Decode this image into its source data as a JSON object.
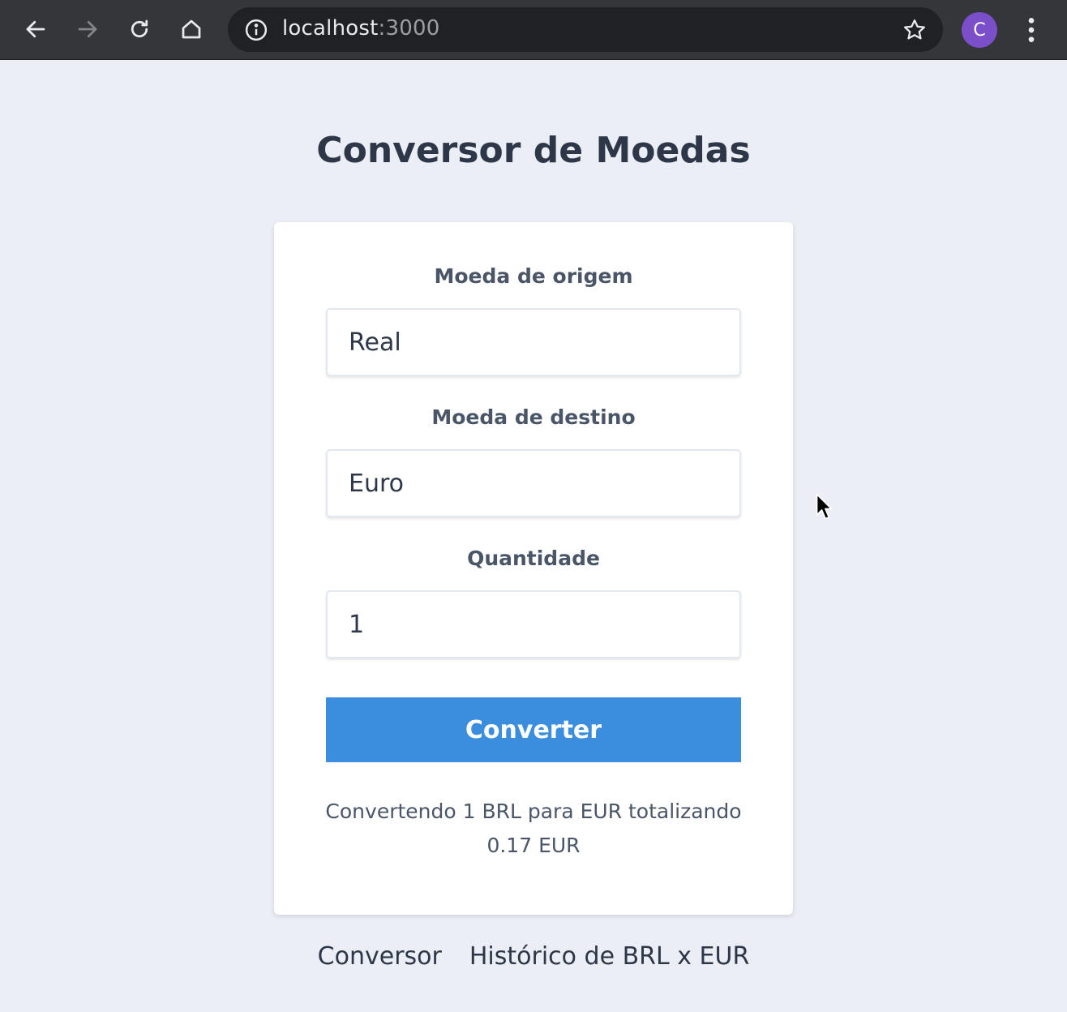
{
  "browser": {
    "url_host": "localhost",
    "url_port": ":3000",
    "profile_initial": "C",
    "avatar_color": "#7b4fc9",
    "icons": [
      "back-arrow-icon",
      "forward-arrow-icon",
      "reload-icon",
      "home-icon",
      "info-icon",
      "star-icon",
      "kebab-menu-icon"
    ]
  },
  "page": {
    "title": "Conversor de Moedas"
  },
  "form": {
    "origin_label": "Moeda de origem",
    "origin_value": "Real",
    "destination_label": "Moeda de destino",
    "destination_value": "Euro",
    "amount_label": "Quantidade",
    "amount_value": "1",
    "convert_button": "Converter"
  },
  "result": {
    "line1": "Convertendo 1 BRL para EUR totalizando",
    "line2": "0.17 EUR"
  },
  "footer": {
    "links": [
      {
        "label": "Conversor"
      },
      {
        "label": "Histórico de BRL x EUR"
      }
    ]
  },
  "colors": {
    "accent": "#3b8ede",
    "background": "#ebeef5",
    "text": "#2d3748"
  }
}
